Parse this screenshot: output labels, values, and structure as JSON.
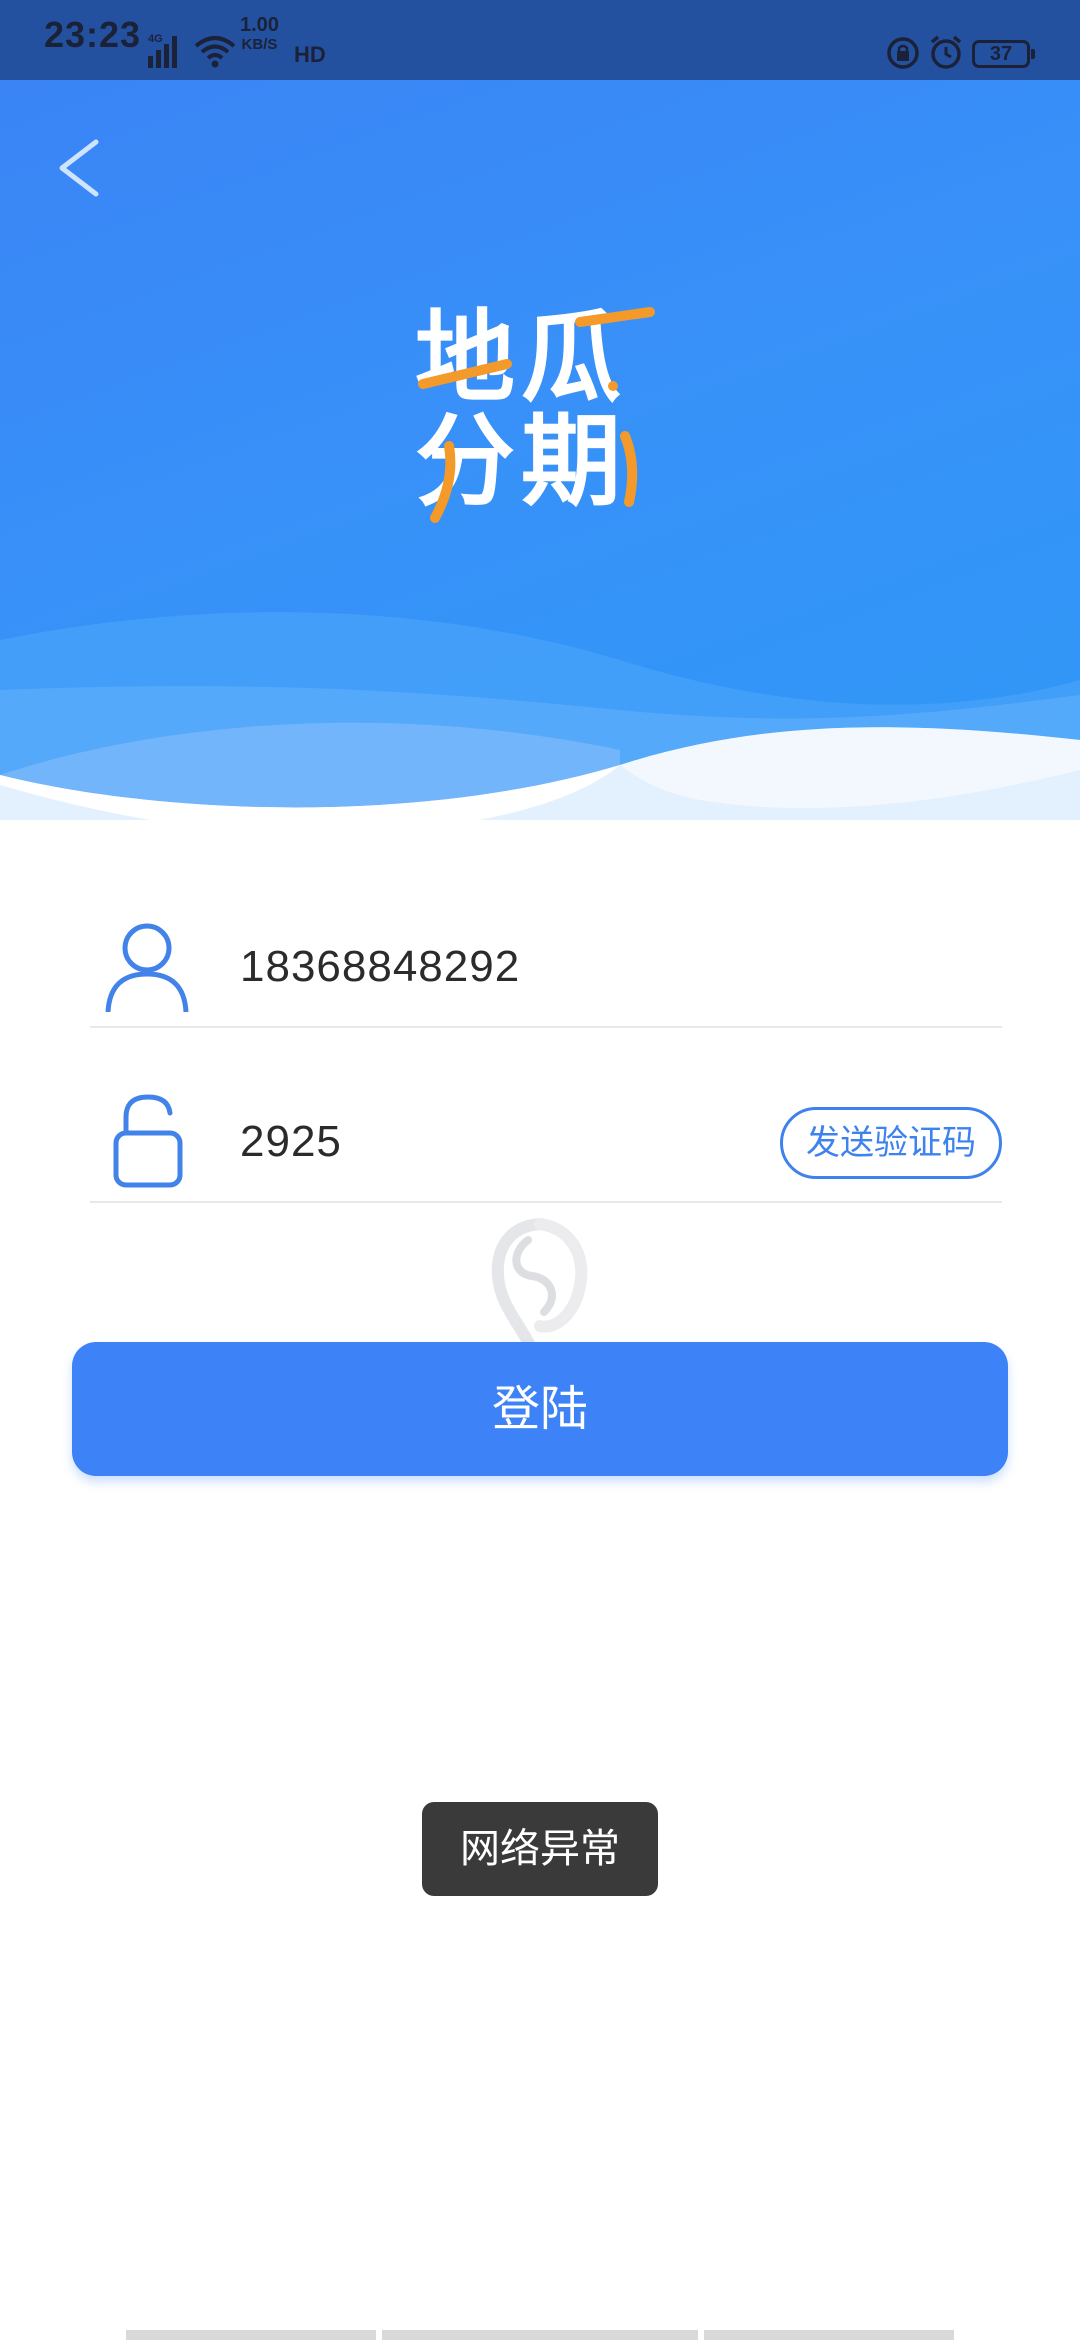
{
  "status_bar": {
    "time": "23:23",
    "network_type": "4G",
    "net_speed_value": "1.00",
    "net_speed_unit": "KB/S",
    "hd_label": "HD",
    "battery": "37"
  },
  "header": {
    "back_icon": "chevron-left-icon",
    "logo_line1": "地瓜",
    "logo_line2": "分期",
    "logo_accent_color": "#f39a2b"
  },
  "form": {
    "phone_icon": "user-icon",
    "phone_value": "18368848292",
    "code_icon": "unlock-icon",
    "code_value": "2925",
    "send_code_label": "发送验证码"
  },
  "login_button": {
    "label": "登陆"
  },
  "toast": {
    "message": "网络异常"
  },
  "colors": {
    "primary": "#3d82f7",
    "header_gradient_start": "#3a84f6",
    "header_gradient_end": "#2e98f6",
    "status_bar_bg": "#2450a0"
  }
}
